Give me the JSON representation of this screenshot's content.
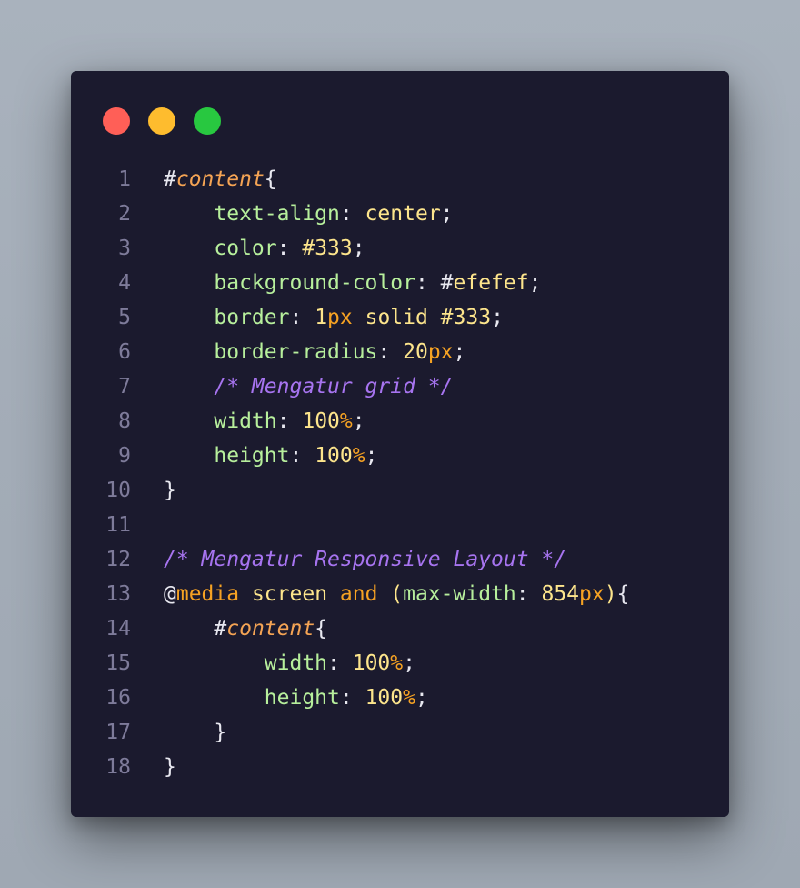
{
  "window": {
    "controls": [
      "red",
      "yellow",
      "green"
    ],
    "colors": {
      "background": "#1b1a2e",
      "red": "#ff5f57",
      "yellow": "#febc2e",
      "green": "#28c840"
    }
  },
  "code": {
    "lines": [
      {
        "n": "1",
        "indent": "",
        "tokens": [
          [
            "#",
            "white"
          ],
          [
            "content",
            "sel"
          ],
          [
            "{",
            "white"
          ]
        ]
      },
      {
        "n": "2",
        "indent": "    ",
        "tokens": [
          [
            "text-align",
            "prop"
          ],
          [
            ": ",
            "white"
          ],
          [
            "center",
            "val"
          ],
          [
            ";",
            "white"
          ]
        ]
      },
      {
        "n": "3",
        "indent": "    ",
        "tokens": [
          [
            "color",
            "prop"
          ],
          [
            ": ",
            "white"
          ],
          [
            "#333",
            "val"
          ],
          [
            ";",
            "white"
          ]
        ]
      },
      {
        "n": "4",
        "indent": "    ",
        "tokens": [
          [
            "background-color",
            "prop"
          ],
          [
            ": ",
            "white"
          ],
          [
            "#",
            "white"
          ],
          [
            "efefef",
            "val"
          ],
          [
            ";",
            "white"
          ]
        ]
      },
      {
        "n": "5",
        "indent": "    ",
        "tokens": [
          [
            "border",
            "prop"
          ],
          [
            ": ",
            "white"
          ],
          [
            "1",
            "num"
          ],
          [
            "px",
            "unit"
          ],
          [
            " solid #333",
            "val"
          ],
          [
            ";",
            "white"
          ]
        ]
      },
      {
        "n": "6",
        "indent": "    ",
        "tokens": [
          [
            "border-radius",
            "prop"
          ],
          [
            ": ",
            "white"
          ],
          [
            "20",
            "num"
          ],
          [
            "px",
            "unit"
          ],
          [
            ";",
            "white"
          ]
        ]
      },
      {
        "n": "7",
        "indent": "    ",
        "tokens": [
          [
            "/* Mengatur grid */",
            "comment"
          ]
        ]
      },
      {
        "n": "8",
        "indent": "    ",
        "tokens": [
          [
            "width",
            "prop"
          ],
          [
            ": ",
            "white"
          ],
          [
            "100",
            "num"
          ],
          [
            "%",
            "unit"
          ],
          [
            ";",
            "white"
          ]
        ]
      },
      {
        "n": "9",
        "indent": "    ",
        "tokens": [
          [
            "height",
            "prop"
          ],
          [
            ": ",
            "white"
          ],
          [
            "100",
            "num"
          ],
          [
            "%",
            "unit"
          ],
          [
            ";",
            "white"
          ]
        ]
      },
      {
        "n": "10",
        "indent": "",
        "tokens": [
          [
            "}",
            "white"
          ]
        ]
      },
      {
        "n": "11",
        "indent": "",
        "tokens": []
      },
      {
        "n": "12",
        "indent": "",
        "tokens": [
          [
            "/* Mengatur Responsive Layout */",
            "comment"
          ]
        ]
      },
      {
        "n": "13",
        "indent": "",
        "tokens": [
          [
            "@",
            "white"
          ],
          [
            "media",
            "at"
          ],
          [
            " screen ",
            "val"
          ],
          [
            "and",
            "kw"
          ],
          [
            " (",
            "val"
          ],
          [
            "max-width",
            "prop"
          ],
          [
            ": ",
            "white"
          ],
          [
            "854",
            "num"
          ],
          [
            "px",
            "unit"
          ],
          [
            ")",
            "val"
          ],
          [
            "{",
            "white"
          ]
        ]
      },
      {
        "n": "14",
        "indent": "    ",
        "tokens": [
          [
            "#",
            "white"
          ],
          [
            "content",
            "sel"
          ],
          [
            "{",
            "white"
          ]
        ]
      },
      {
        "n": "15",
        "indent": "        ",
        "tokens": [
          [
            "width",
            "prop"
          ],
          [
            ": ",
            "white"
          ],
          [
            "100",
            "num"
          ],
          [
            "%",
            "unit"
          ],
          [
            ";",
            "white"
          ]
        ]
      },
      {
        "n": "16",
        "indent": "        ",
        "tokens": [
          [
            "height",
            "prop"
          ],
          [
            ": ",
            "white"
          ],
          [
            "100",
            "num"
          ],
          [
            "%",
            "unit"
          ],
          [
            ";",
            "white"
          ]
        ]
      },
      {
        "n": "17",
        "indent": "    ",
        "tokens": [
          [
            "}",
            "white"
          ]
        ]
      },
      {
        "n": "18",
        "indent": "",
        "tokens": [
          [
            "}",
            "white"
          ]
        ]
      }
    ]
  }
}
